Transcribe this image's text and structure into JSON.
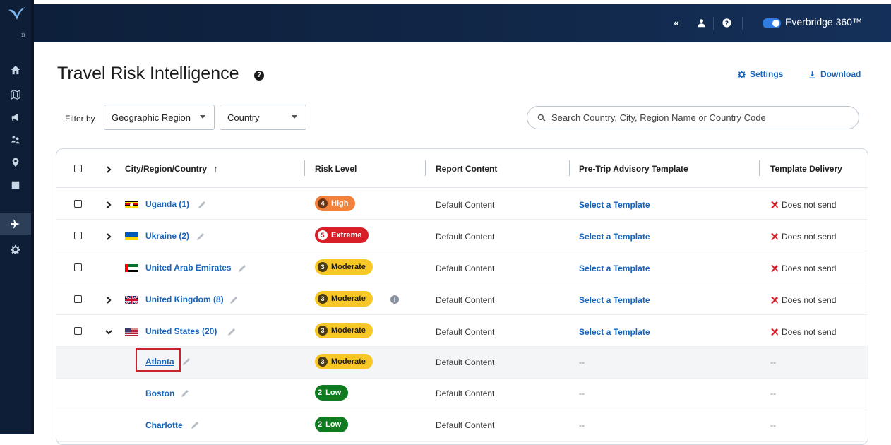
{
  "header": {
    "brand": "Everbridge 360™",
    "icons": [
      "collapse-icon",
      "user-icon",
      "help-icon"
    ]
  },
  "page": {
    "title": "Travel Risk Intelligence",
    "settings_label": "Settings",
    "download_label": "Download"
  },
  "filters": {
    "label": "Filter by",
    "region_select": "Geographic Region",
    "country_select": "Country",
    "search_placeholder": "Search Country, City, Region Name or Country Code"
  },
  "table": {
    "columns": [
      "City/Region/Country",
      "Risk Level",
      "Report Content",
      "Pre-Trip Advisory Template",
      "Template Delivery"
    ],
    "rows": [
      {
        "name": "Uganda (1)",
        "risk_num": "4",
        "risk_label": "High",
        "risk_class": "high",
        "report": "Default Content",
        "template": "Select a Template",
        "delivery": "Does not send"
      },
      {
        "name": "Ukraine (2)",
        "risk_num": "5",
        "risk_label": "Extreme",
        "risk_class": "extreme",
        "report": "Default Content",
        "template": "Select a Template",
        "delivery": "Does not send"
      },
      {
        "name": "United Arab Emirates",
        "risk_num": "3",
        "risk_label": "Moderate",
        "risk_class": "moderate",
        "report": "Default Content",
        "template": "Select a Template",
        "delivery": "Does not send"
      },
      {
        "name": "United Kingdom (8)",
        "risk_num": "3",
        "risk_label": "Moderate",
        "risk_class": "moderate",
        "report": "Default Content",
        "template": "Select a Template",
        "delivery": "Does not send"
      },
      {
        "name": "United States (20)",
        "risk_num": "3",
        "risk_label": "Moderate",
        "risk_class": "moderate",
        "report": "Default Content",
        "template": "Select a Template",
        "delivery": "Does not send"
      },
      {
        "name": "Atlanta",
        "risk_num": "3",
        "risk_label": "Moderate",
        "risk_class": "moderate",
        "report": "Default Content",
        "template": "--",
        "delivery": "--"
      },
      {
        "name": "Boston",
        "risk_num": "2",
        "risk_label": "Low",
        "risk_class": "low",
        "report": "Default Content",
        "template": "--",
        "delivery": "--"
      },
      {
        "name": "Charlotte",
        "risk_num": "2",
        "risk_label": "Low",
        "risk_class": "low",
        "report": "Default Content",
        "template": "--",
        "delivery": "--"
      }
    ]
  },
  "colors": {
    "accent": "#1565c0",
    "high": "#f2813b",
    "extreme": "#d81f28",
    "moderate": "#f7c627",
    "low": "#0f7a1f",
    "nav_bg": "#0e1e36"
  }
}
